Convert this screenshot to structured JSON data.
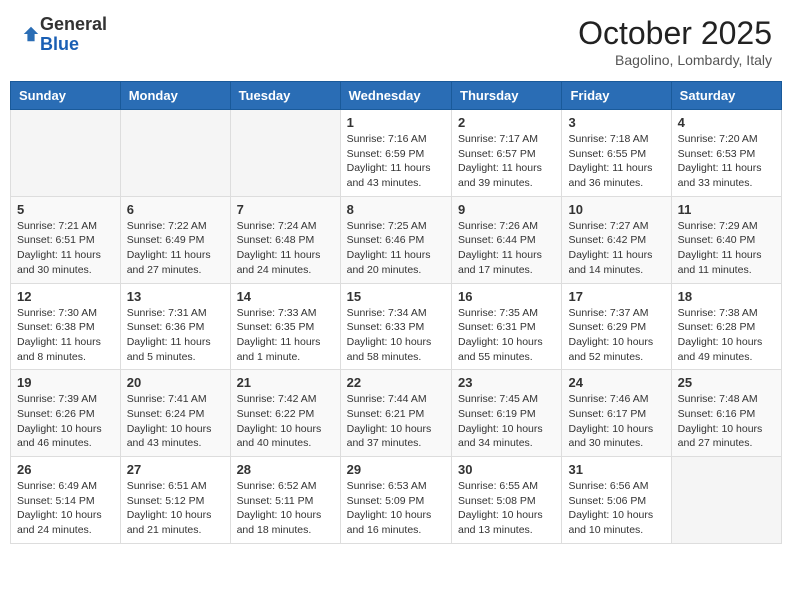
{
  "logo": {
    "general": "General",
    "blue": "Blue"
  },
  "title": "October 2025",
  "location": "Bagolino, Lombardy, Italy",
  "weekdays": [
    "Sunday",
    "Monday",
    "Tuesday",
    "Wednesday",
    "Thursday",
    "Friday",
    "Saturday"
  ],
  "weeks": [
    [
      {
        "day": "",
        "info": ""
      },
      {
        "day": "",
        "info": ""
      },
      {
        "day": "",
        "info": ""
      },
      {
        "day": "1",
        "info": "Sunrise: 7:16 AM\nSunset: 6:59 PM\nDaylight: 11 hours and 43 minutes."
      },
      {
        "day": "2",
        "info": "Sunrise: 7:17 AM\nSunset: 6:57 PM\nDaylight: 11 hours and 39 minutes."
      },
      {
        "day": "3",
        "info": "Sunrise: 7:18 AM\nSunset: 6:55 PM\nDaylight: 11 hours and 36 minutes."
      },
      {
        "day": "4",
        "info": "Sunrise: 7:20 AM\nSunset: 6:53 PM\nDaylight: 11 hours and 33 minutes."
      }
    ],
    [
      {
        "day": "5",
        "info": "Sunrise: 7:21 AM\nSunset: 6:51 PM\nDaylight: 11 hours and 30 minutes."
      },
      {
        "day": "6",
        "info": "Sunrise: 7:22 AM\nSunset: 6:49 PM\nDaylight: 11 hours and 27 minutes."
      },
      {
        "day": "7",
        "info": "Sunrise: 7:24 AM\nSunset: 6:48 PM\nDaylight: 11 hours and 24 minutes."
      },
      {
        "day": "8",
        "info": "Sunrise: 7:25 AM\nSunset: 6:46 PM\nDaylight: 11 hours and 20 minutes."
      },
      {
        "day": "9",
        "info": "Sunrise: 7:26 AM\nSunset: 6:44 PM\nDaylight: 11 hours and 17 minutes."
      },
      {
        "day": "10",
        "info": "Sunrise: 7:27 AM\nSunset: 6:42 PM\nDaylight: 11 hours and 14 minutes."
      },
      {
        "day": "11",
        "info": "Sunrise: 7:29 AM\nSunset: 6:40 PM\nDaylight: 11 hours and 11 minutes."
      }
    ],
    [
      {
        "day": "12",
        "info": "Sunrise: 7:30 AM\nSunset: 6:38 PM\nDaylight: 11 hours and 8 minutes."
      },
      {
        "day": "13",
        "info": "Sunrise: 7:31 AM\nSunset: 6:36 PM\nDaylight: 11 hours and 5 minutes."
      },
      {
        "day": "14",
        "info": "Sunrise: 7:33 AM\nSunset: 6:35 PM\nDaylight: 11 hours and 1 minute."
      },
      {
        "day": "15",
        "info": "Sunrise: 7:34 AM\nSunset: 6:33 PM\nDaylight: 10 hours and 58 minutes."
      },
      {
        "day": "16",
        "info": "Sunrise: 7:35 AM\nSunset: 6:31 PM\nDaylight: 10 hours and 55 minutes."
      },
      {
        "day": "17",
        "info": "Sunrise: 7:37 AM\nSunset: 6:29 PM\nDaylight: 10 hours and 52 minutes."
      },
      {
        "day": "18",
        "info": "Sunrise: 7:38 AM\nSunset: 6:28 PM\nDaylight: 10 hours and 49 minutes."
      }
    ],
    [
      {
        "day": "19",
        "info": "Sunrise: 7:39 AM\nSunset: 6:26 PM\nDaylight: 10 hours and 46 minutes."
      },
      {
        "day": "20",
        "info": "Sunrise: 7:41 AM\nSunset: 6:24 PM\nDaylight: 10 hours and 43 minutes."
      },
      {
        "day": "21",
        "info": "Sunrise: 7:42 AM\nSunset: 6:22 PM\nDaylight: 10 hours and 40 minutes."
      },
      {
        "day": "22",
        "info": "Sunrise: 7:44 AM\nSunset: 6:21 PM\nDaylight: 10 hours and 37 minutes."
      },
      {
        "day": "23",
        "info": "Sunrise: 7:45 AM\nSunset: 6:19 PM\nDaylight: 10 hours and 34 minutes."
      },
      {
        "day": "24",
        "info": "Sunrise: 7:46 AM\nSunset: 6:17 PM\nDaylight: 10 hours and 30 minutes."
      },
      {
        "day": "25",
        "info": "Sunrise: 7:48 AM\nSunset: 6:16 PM\nDaylight: 10 hours and 27 minutes."
      }
    ],
    [
      {
        "day": "26",
        "info": "Sunrise: 6:49 AM\nSunset: 5:14 PM\nDaylight: 10 hours and 24 minutes."
      },
      {
        "day": "27",
        "info": "Sunrise: 6:51 AM\nSunset: 5:12 PM\nDaylight: 10 hours and 21 minutes."
      },
      {
        "day": "28",
        "info": "Sunrise: 6:52 AM\nSunset: 5:11 PM\nDaylight: 10 hours and 18 minutes."
      },
      {
        "day": "29",
        "info": "Sunrise: 6:53 AM\nSunset: 5:09 PM\nDaylight: 10 hours and 16 minutes."
      },
      {
        "day": "30",
        "info": "Sunrise: 6:55 AM\nSunset: 5:08 PM\nDaylight: 10 hours and 13 minutes."
      },
      {
        "day": "31",
        "info": "Sunrise: 6:56 AM\nSunset: 5:06 PM\nDaylight: 10 hours and 10 minutes."
      },
      {
        "day": "",
        "info": ""
      }
    ]
  ]
}
